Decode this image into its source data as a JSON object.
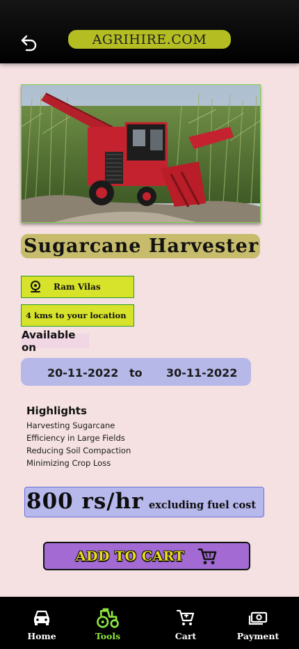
{
  "header": {
    "brand": "AGRIHIRE.COM"
  },
  "equipment": {
    "title": "Sugarcane Harvester",
    "owner": "Ram Vilas",
    "distance": "4 kms to your location",
    "availability_label": "Available on",
    "date_from": "20-11-2022",
    "date_separator": "to",
    "date_to": "30-11-2022"
  },
  "highlights": {
    "heading": "Highlights",
    "items": [
      "Harvesting Sugarcane",
      "Efficiency in Large Fields",
      "Reducing Soil Compaction",
      "Minimizing Crop Loss"
    ]
  },
  "pricing": {
    "rate": "800 rs/hr",
    "note": "excluding fuel cost"
  },
  "actions": {
    "add_to_cart": "ADD TO CART"
  },
  "nav": {
    "active": "Tools",
    "items": [
      {
        "label": "Home",
        "icon": "car-icon"
      },
      {
        "label": "Tools",
        "icon": "tractor-icon"
      },
      {
        "label": "Cart",
        "icon": "cart-icon"
      },
      {
        "label": "Payment",
        "icon": "money-icon"
      }
    ]
  },
  "colors": {
    "background": "#f5e1e1",
    "brand_pill": "#b4bd22",
    "chip": "#d7e22a",
    "date_bar": "#b6b8e8",
    "cart_button": "#a26ad2",
    "nav_active": "#8ee63f"
  }
}
